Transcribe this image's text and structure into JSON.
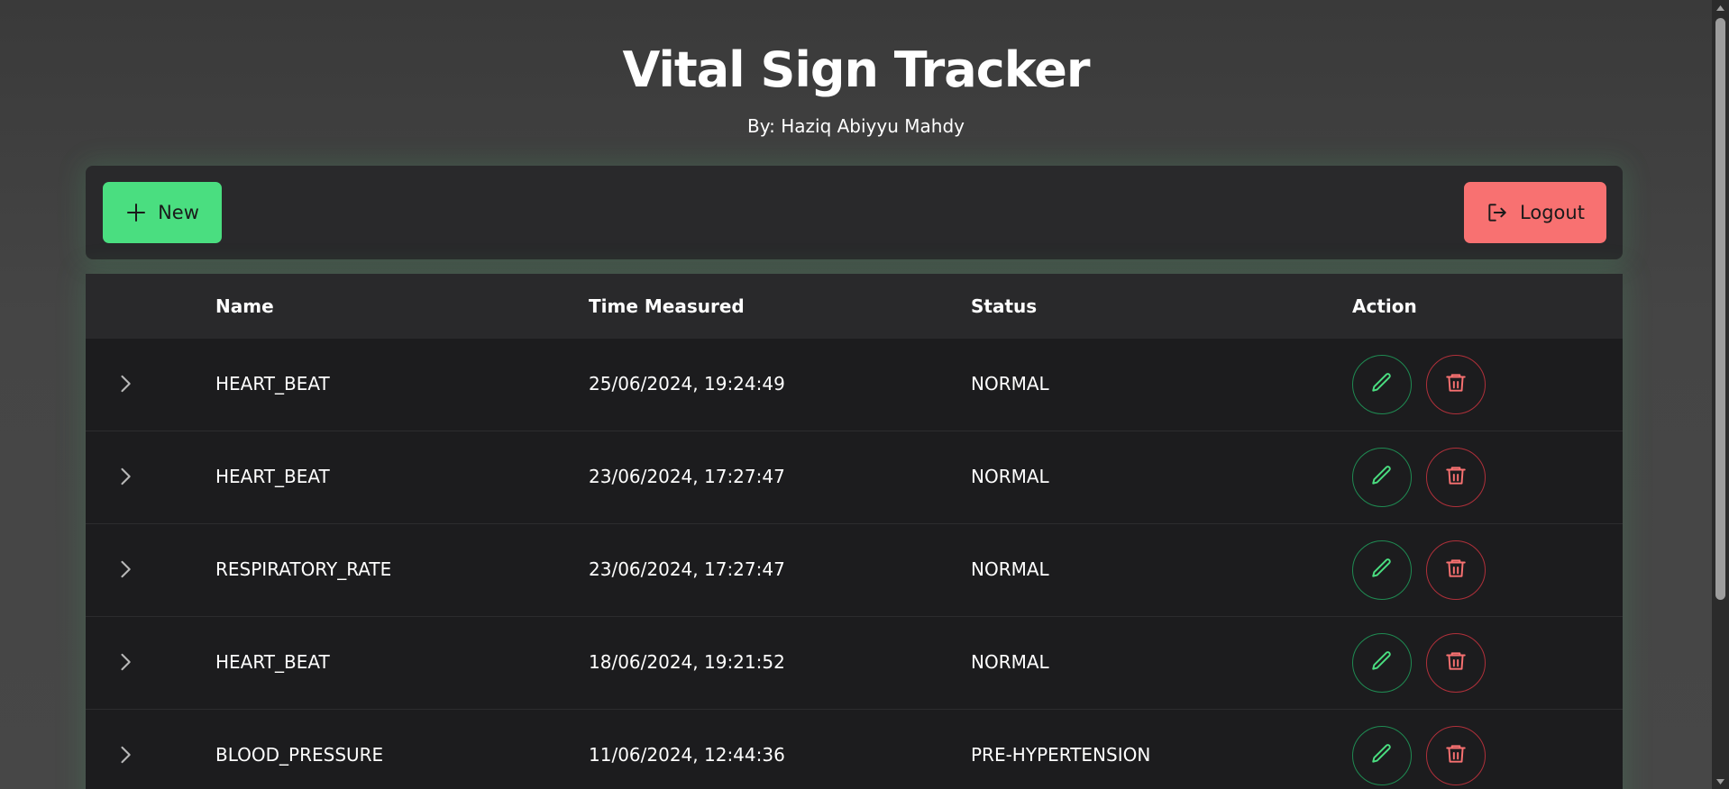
{
  "app": {
    "title": "Vital Sign Tracker",
    "subtitle": "By: Haziq Abiyyu Mahdy"
  },
  "toolbar": {
    "new_label": "New",
    "logout_label": "Logout"
  },
  "table": {
    "columns": [
      "Name",
      "Time Measured",
      "Status",
      "Action"
    ],
    "rows": [
      {
        "name": "HEART_BEAT",
        "time": "25/06/2024, 19:24:49",
        "status": "NORMAL"
      },
      {
        "name": "HEART_BEAT",
        "time": "23/06/2024, 17:27:47",
        "status": "NORMAL"
      },
      {
        "name": "RESPIRATORY_RATE",
        "time": "23/06/2024, 17:27:47",
        "status": "NORMAL"
      },
      {
        "name": "HEART_BEAT",
        "time": "18/06/2024, 19:21:52",
        "status": "NORMAL"
      },
      {
        "name": "BLOOD_PRESSURE",
        "time": "11/06/2024, 12:44:36",
        "status": "PRE-HYPERTENSION"
      }
    ]
  },
  "colors": {
    "background": "#424242",
    "panel": "#29292b",
    "table_body": "#1c1c1e",
    "accent_green": "#4ade80",
    "accent_red": "#f87171"
  },
  "icons": {
    "new": "plus-icon",
    "logout": "logout-icon",
    "expand": "chevron-right-icon",
    "edit": "pencil-icon",
    "delete": "trash-icon"
  }
}
